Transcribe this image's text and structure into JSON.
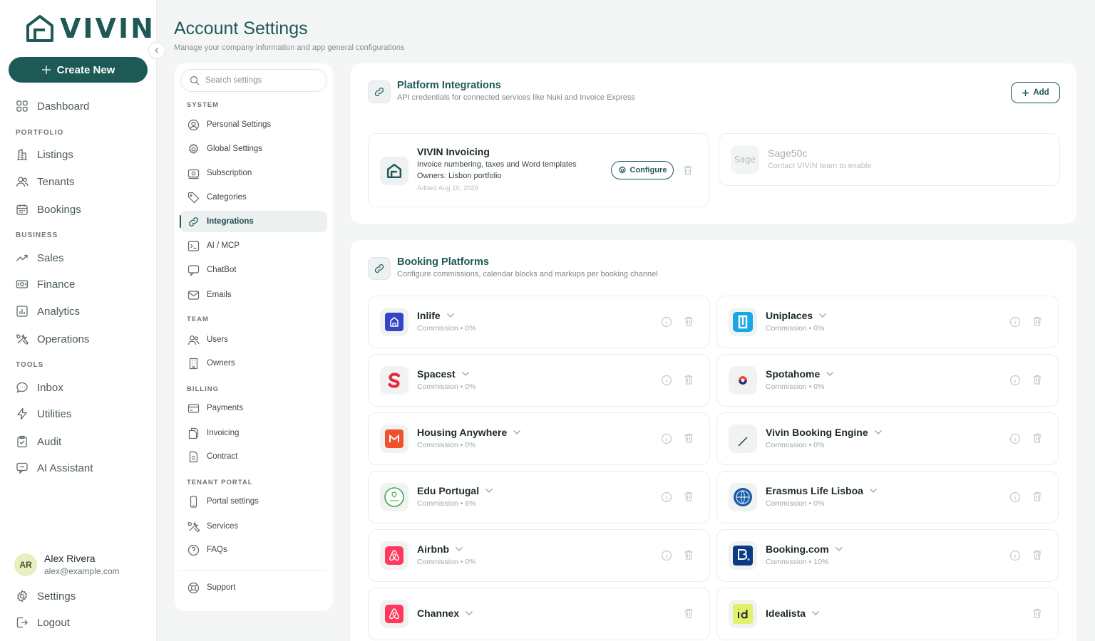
{
  "brand": {
    "name": "VIVIN",
    "accent": "#1d5a55"
  },
  "sidebar": {
    "create_label": "Create New",
    "items": [
      {
        "label": "Dashboard",
        "icon": "grid-icon"
      },
      {
        "section": "PORTFOLIO"
      },
      {
        "label": "Listings",
        "icon": "building-icon"
      },
      {
        "label": "Tenants",
        "icon": "users-icon"
      },
      {
        "label": "Bookings",
        "icon": "calendar-icon"
      },
      {
        "section": "BUSINESS"
      },
      {
        "label": "Sales",
        "icon": "trending-up-icon"
      },
      {
        "label": "Finance",
        "icon": "money-icon"
      },
      {
        "label": "Analytics",
        "icon": "bar-chart-icon"
      },
      {
        "label": "Operations",
        "icon": "tools-icon"
      },
      {
        "section": "TOOLS"
      },
      {
        "label": "Inbox",
        "icon": "chat-icon"
      },
      {
        "label": "Utilities",
        "icon": "bolt-icon"
      },
      {
        "label": "Audit",
        "icon": "clipboard-icon"
      },
      {
        "label": "AI Assistant",
        "icon": "ai-chat-icon"
      }
    ],
    "user": {
      "initials": "AR",
      "name": "Alex Rivera",
      "email": "alex@example.com"
    },
    "settings_label": "Settings",
    "logout_label": "Logout"
  },
  "header": {
    "title": "Account Settings",
    "subtitle": "Manage your company information and app general configurations"
  },
  "settings_nav": {
    "search_placeholder": "Search settings",
    "sections": [
      {
        "title": "SYSTEM",
        "items": [
          "Personal Settings",
          "Global Settings",
          "Subscription",
          "Categories",
          "Integrations",
          "AI / MCP",
          "ChatBot",
          "Emails"
        ]
      },
      {
        "title": "TEAM",
        "items": [
          "Users",
          "Owners"
        ]
      },
      {
        "title": "BILLING",
        "items": [
          "Payments",
          "Invoicing",
          "Contract"
        ]
      },
      {
        "title": "TENANT PORTAL",
        "items": [
          "Portal settings",
          "Services",
          "FAQs"
        ]
      }
    ],
    "support_label": "Support",
    "active": "Integrations"
  },
  "platform_integrations": {
    "title": "Platform Integrations",
    "description": "API credentials for connected services like Nuki and Invoice Express",
    "add_label": "Add",
    "items": [
      {
        "name": "VIVIN Invoicing",
        "line1": "Invoice numbering, taxes and Word templates",
        "line2": "Owners: Lisbon portfolio",
        "added": "Added Aug 10, 2026",
        "configure_label": "Configure"
      },
      {
        "name": "Sage50c",
        "line1": "Contact VIVIN team to enable",
        "logo_text": "Sage"
      }
    ]
  },
  "booking_platforms": {
    "title": "Booking Platforms",
    "description": "Configure commissions, calendar blocks and markups per booking channel",
    "items": [
      {
        "name": "Inlife",
        "commission": "Commission • 0%",
        "logo_color": "#3446c8"
      },
      {
        "name": "Uniplaces",
        "commission": "Commission • 0%",
        "logo_color": "#17a6e6"
      },
      {
        "name": "Spacest",
        "commission": "Commission • 0%",
        "logo_color": "#e5283b"
      },
      {
        "name": "Spotahome",
        "commission": "Commission • 0%",
        "logo_color": "#e94a3c"
      },
      {
        "name": "Housing Anywhere",
        "commission": "Commission • 0%",
        "logo_color": "#f0512e"
      },
      {
        "name": "Vivin Booking Engine",
        "commission": "Commission • 0%",
        "logo_color": "#1e2a2a"
      },
      {
        "name": "Edu Portugal",
        "commission": "Commission • 8%",
        "logo_color": "#3aa84f"
      },
      {
        "name": "Erasmus Life Lisboa",
        "commission": "Commission • 0%",
        "logo_color": "#1a5ea8"
      },
      {
        "name": "Airbnb",
        "commission": "Commission • 0%",
        "logo_color": "#ff385c"
      },
      {
        "name": "Booking.com",
        "commission": "Commission • 10%",
        "logo_color": "#0c3b84"
      },
      {
        "name": "Channex",
        "commission": "",
        "logo_color": "#ff385c"
      },
      {
        "name": "Idealista",
        "commission": "",
        "logo_color": "#e3f06b"
      }
    ]
  }
}
